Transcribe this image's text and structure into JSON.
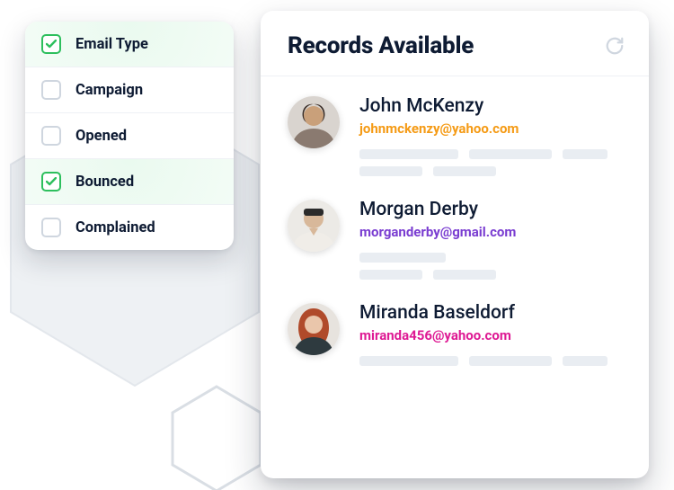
{
  "filters": {
    "items": [
      {
        "label": "Email Type",
        "checked": true
      },
      {
        "label": "Campaign",
        "checked": false
      },
      {
        "label": "Opened",
        "checked": false
      },
      {
        "label": "Bounced",
        "checked": true
      },
      {
        "label": "Complained",
        "checked": false
      }
    ]
  },
  "records": {
    "title": "Records Available",
    "people": [
      {
        "name": "John McKenzy",
        "email": "johnmckenzy@yahoo.com",
        "emailColor": "orange"
      },
      {
        "name": "Morgan Derby",
        "email": "morganderby@gmail.com",
        "emailColor": "purple"
      },
      {
        "name": "Miranda Baseldorf",
        "email": "miranda456@yahoo.com",
        "emailColor": "magenta"
      }
    ]
  }
}
